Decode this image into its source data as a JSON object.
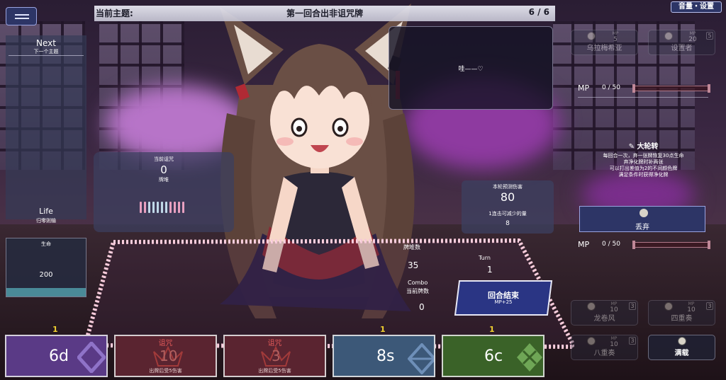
{
  "header": {
    "theme_label": "当前主题:",
    "theme_title": "第一回合出非诅咒牌",
    "progress": "6 / 6"
  },
  "volume_settings_label": "音量・设置",
  "next_panel": {
    "title": "Next",
    "subtitle": "下一个主题"
  },
  "life_panel": {
    "title": "Life",
    "subtitle": "归零则输",
    "box_label": "生命",
    "value": "200",
    "fill_fraction": 0.15
  },
  "curse_panel": {
    "title": "当前诅咒",
    "value": "0",
    "subtitle": "牌堆"
  },
  "speech": {
    "text": "哇——♡"
  },
  "damage_panel": {
    "title": "本轮预测伤害",
    "value": "80",
    "sub_label": "1连击可减少的量",
    "sub_value": "8"
  },
  "stats": {
    "deck_label": "牌堆数",
    "deck_value": "35",
    "turn_label": "Turn",
    "turn_value": "1",
    "combo_label": "Combo",
    "combo_sub_label": "当前牌数",
    "combo_value": "0"
  },
  "end_turn": {
    "label": "回合结束",
    "sub": "MP+25"
  },
  "right_slots_top": [
    {
      "mp_label": "MP",
      "mp": "5",
      "name": "乌拉梅希亚",
      "count": ""
    },
    {
      "mp_label": "MP",
      "mp": "20",
      "name": "设置者",
      "count": "5"
    }
  ],
  "mp_rows": [
    {
      "label": "MP",
      "value": "0 / 50"
    },
    {
      "label": "MP",
      "value": "0 / 50"
    }
  ],
  "skill": {
    "name": "大轮转",
    "desc_lines": [
      "每回合一次，弃一张牌恢复30点生命",
      "弃净化牌时补两张",
      "可以打出差值为2的不同颜色牌",
      "满足条件时获得净化牌"
    ]
  },
  "discard_button": {
    "label": "丢弃"
  },
  "right_slots_bottom": [
    {
      "mp_label": "MP",
      "mp": "10",
      "name": "龙卷风",
      "count": "3"
    },
    {
      "mp_label": "MP",
      "mp": "10",
      "name": "四重奏",
      "count": "3"
    },
    {
      "mp_label": "MP",
      "mp": "10",
      "name": "八重奏",
      "count": "3"
    },
    {
      "mp_label": "",
      "mp": "",
      "name": "满载",
      "count": ""
    }
  ],
  "hand": [
    {
      "kind": "normal",
      "value": "6d",
      "cost": "1",
      "color": "#5a3a86",
      "icon_color": "#8f73c8"
    },
    {
      "kind": "curse",
      "title": "诅咒",
      "value": "10",
      "desc": "出牌后受5伤害",
      "color": "#5a2430"
    },
    {
      "kind": "curse",
      "title": "诅咒",
      "value": "3",
      "desc": "出牌后受5伤害",
      "color": "#5a2430"
    },
    {
      "kind": "normal",
      "value": "8s",
      "cost": "1",
      "color": "#3c5878",
      "icon_color": "#6e8fb8"
    },
    {
      "kind": "normal",
      "value": "6c",
      "cost": "1",
      "color": "#3a6228",
      "icon_color": "#6fa656"
    }
  ],
  "colors": {
    "accent": "#2d3566",
    "cost": "#f0d030",
    "curse": "#e05858",
    "frame_blossom": "#f6c8d8"
  }
}
